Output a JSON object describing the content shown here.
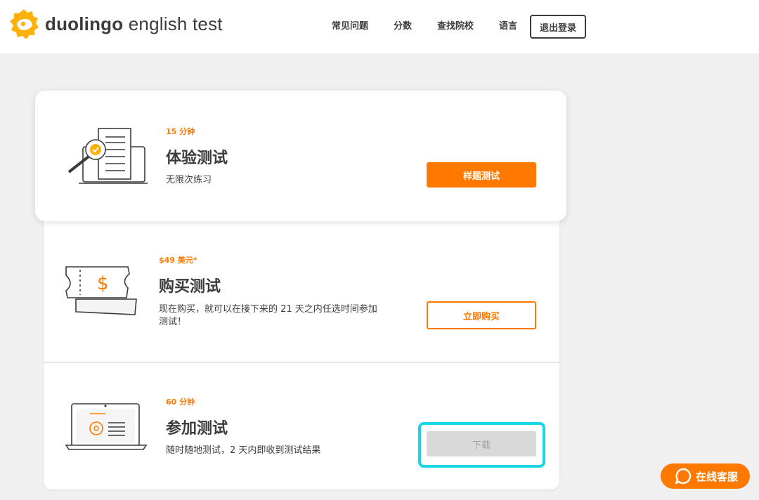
{
  "header": {
    "brand": "duolingo",
    "product": " english test",
    "nav": [
      "常见问题",
      "分数",
      "查找院校",
      "语言"
    ],
    "logout_label": "退出登录"
  },
  "cards": [
    {
      "meta": "15 分钟",
      "title": "体验测试",
      "desc": "无限次练习",
      "button": "样题测试",
      "icon": "magnifier-document-icon"
    },
    {
      "meta": "$49 美元*",
      "title": "购买测试",
      "desc_line1": "现在购买，就可以在接下来的 21 天之内任选时间参加",
      "desc_line2": "测试！",
      "button": "立即购买",
      "icon": "ticket-dollar-icon"
    },
    {
      "meta": "60 分钟",
      "title": "参加测试",
      "desc": "随时随地测试，2 天内即收到测试结果",
      "button": "下载",
      "button_state": "disabled",
      "icon": "laptop-icon"
    }
  ],
  "chat": {
    "label": "在线客服"
  },
  "colors": {
    "accent": "#ff7900",
    "focus": "#19d6e6",
    "text": "#3c3c3c"
  }
}
